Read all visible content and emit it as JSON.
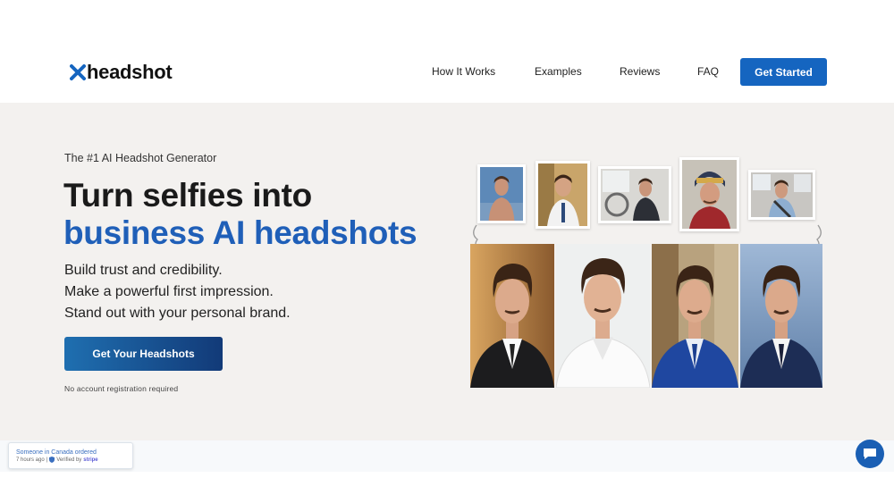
{
  "header": {
    "logo_text": "headshot",
    "nav": [
      {
        "label": "How It Works"
      },
      {
        "label": "Examples"
      },
      {
        "label": "Reviews"
      },
      {
        "label": "FAQ"
      }
    ],
    "cta_label": "Get Started"
  },
  "hero": {
    "eyebrow": "The #1 AI Headshot Generator",
    "headline_line1": "Turn selfies into",
    "headline_line2": "business AI headshots",
    "sublines": [
      "Build trust and credibility.",
      "Make a powerful first impression.",
      "Stand out with your personal brand."
    ],
    "cta_label": "Get Your Headshots",
    "note": "No account registration required"
  },
  "social_proof": {
    "line1": "Someone in Canada ordered",
    "time": "7 hours ago",
    "separator": "|",
    "verified_prefix": "Verified by",
    "verified_brand": "stripe"
  },
  "icons": {
    "logo": "x-logo-icon",
    "chat": "chat-bubble-icon",
    "verified": "shield-check-icon"
  },
  "colors": {
    "accent": "#1565c0",
    "headline_blue": "#1f5fb8",
    "hero_bg": "#f3f1ef"
  }
}
